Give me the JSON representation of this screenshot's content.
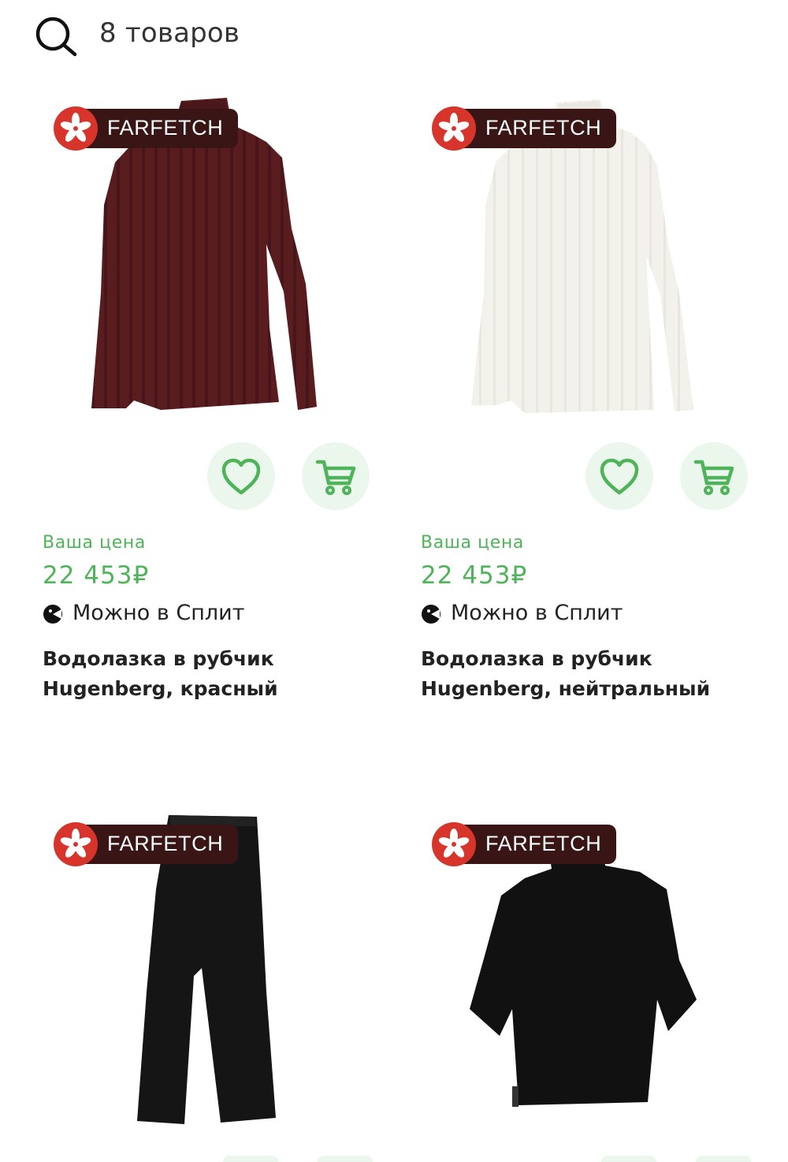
{
  "header": {
    "results_count": "8 товаров",
    "search_icon": "search-icon"
  },
  "colors": {
    "accent_green": "#4fb35a",
    "button_bg": "#ebf7ec",
    "badge_bg": "#3a1515",
    "badge_flag": "#d7352b"
  },
  "products": [
    {
      "seller": "FARFETCH",
      "price_label": "Ваша цена",
      "price": "22 453₽",
      "split": "Можно в Сплит",
      "title_line1": "Водолазка в рубчик",
      "title_line2": "Hugenberg, красный",
      "image": "burgundy-ribbed-turtleneck"
    },
    {
      "seller": "FARFETCH",
      "price_label": "Ваша цена",
      "price": "22 453₽",
      "split": "Можно в Сплит",
      "title_line1": "Водолазка в рубчик",
      "title_line2": "Hugenberg, нейтральный",
      "image": "white-ribbed-turtleneck"
    },
    {
      "seller": "FARFETCH",
      "image": "black-wide-trousers"
    },
    {
      "seller": "FARFETCH",
      "image": "black-short-sleeve-turtleneck"
    }
  ]
}
